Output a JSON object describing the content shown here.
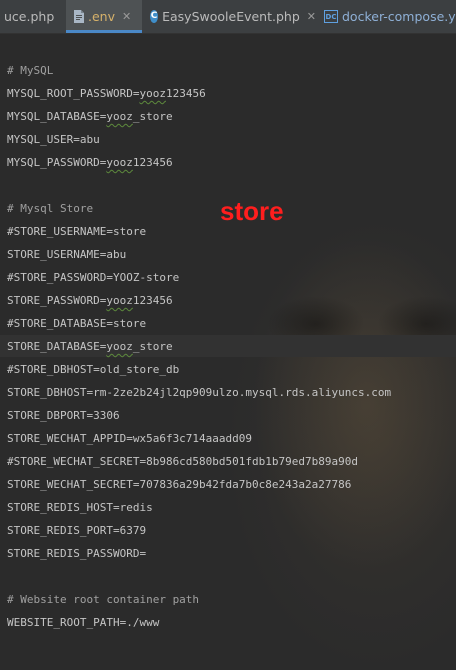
{
  "tabs": [
    {
      "label": "uce.php",
      "icon": "php-file-icon",
      "active": false
    },
    {
      "label": ".env",
      "icon": "file-icon",
      "active": true
    },
    {
      "label": "EasySwooleEvent.php",
      "icon": "class-icon",
      "active": false
    },
    {
      "label": "docker-compose.yml",
      "icon": "docker-compose-icon",
      "active": false
    }
  ],
  "lines": [
    "# MySQL",
    "MYSQL_ROOT_PASSWORD=yooz123456",
    "MYSQL_DATABASE=yooz_store",
    "MYSQL_USER=abu",
    "MYSQL_PASSWORD=yooz123456",
    "",
    "# Mysql Store",
    "#STORE_USERNAME=store",
    "STORE_USERNAME=abu",
    "#STORE_PASSWORD=YOOZ-store",
    "STORE_PASSWORD=yooz123456",
    "#STORE_DATABASE=store",
    "STORE_DATABASE=yooz_store",
    "#STORE_DBHOST=old_store_db",
    "STORE_DBHOST=rm-2ze2b24jl2qp909ulzo.mysql.rds.aliyuncs.com",
    "STORE_DBPORT=3306",
    "STORE_WECHAT_APPID=wx5a6f3c714aaadd09",
    "#STORE_WECHAT_SECRET=8b986cd580bd501fdb1b79ed7b89a90d",
    "STORE_WECHAT_SECRET=707836a29b42fda7b0c8e243a2a27786",
    "STORE_REDIS_HOST=redis",
    "STORE_REDIS_PORT=6379",
    "STORE_REDIS_PASSWORD=",
    "",
    "# Website root container path",
    "WEBSITE_ROOT_PATH=./www"
  ],
  "overlay_label": "store",
  "colors": {
    "accent": "#4a88c7",
    "overlay": "#ff1e1e",
    "editor_bg": "#2b2b2b"
  }
}
